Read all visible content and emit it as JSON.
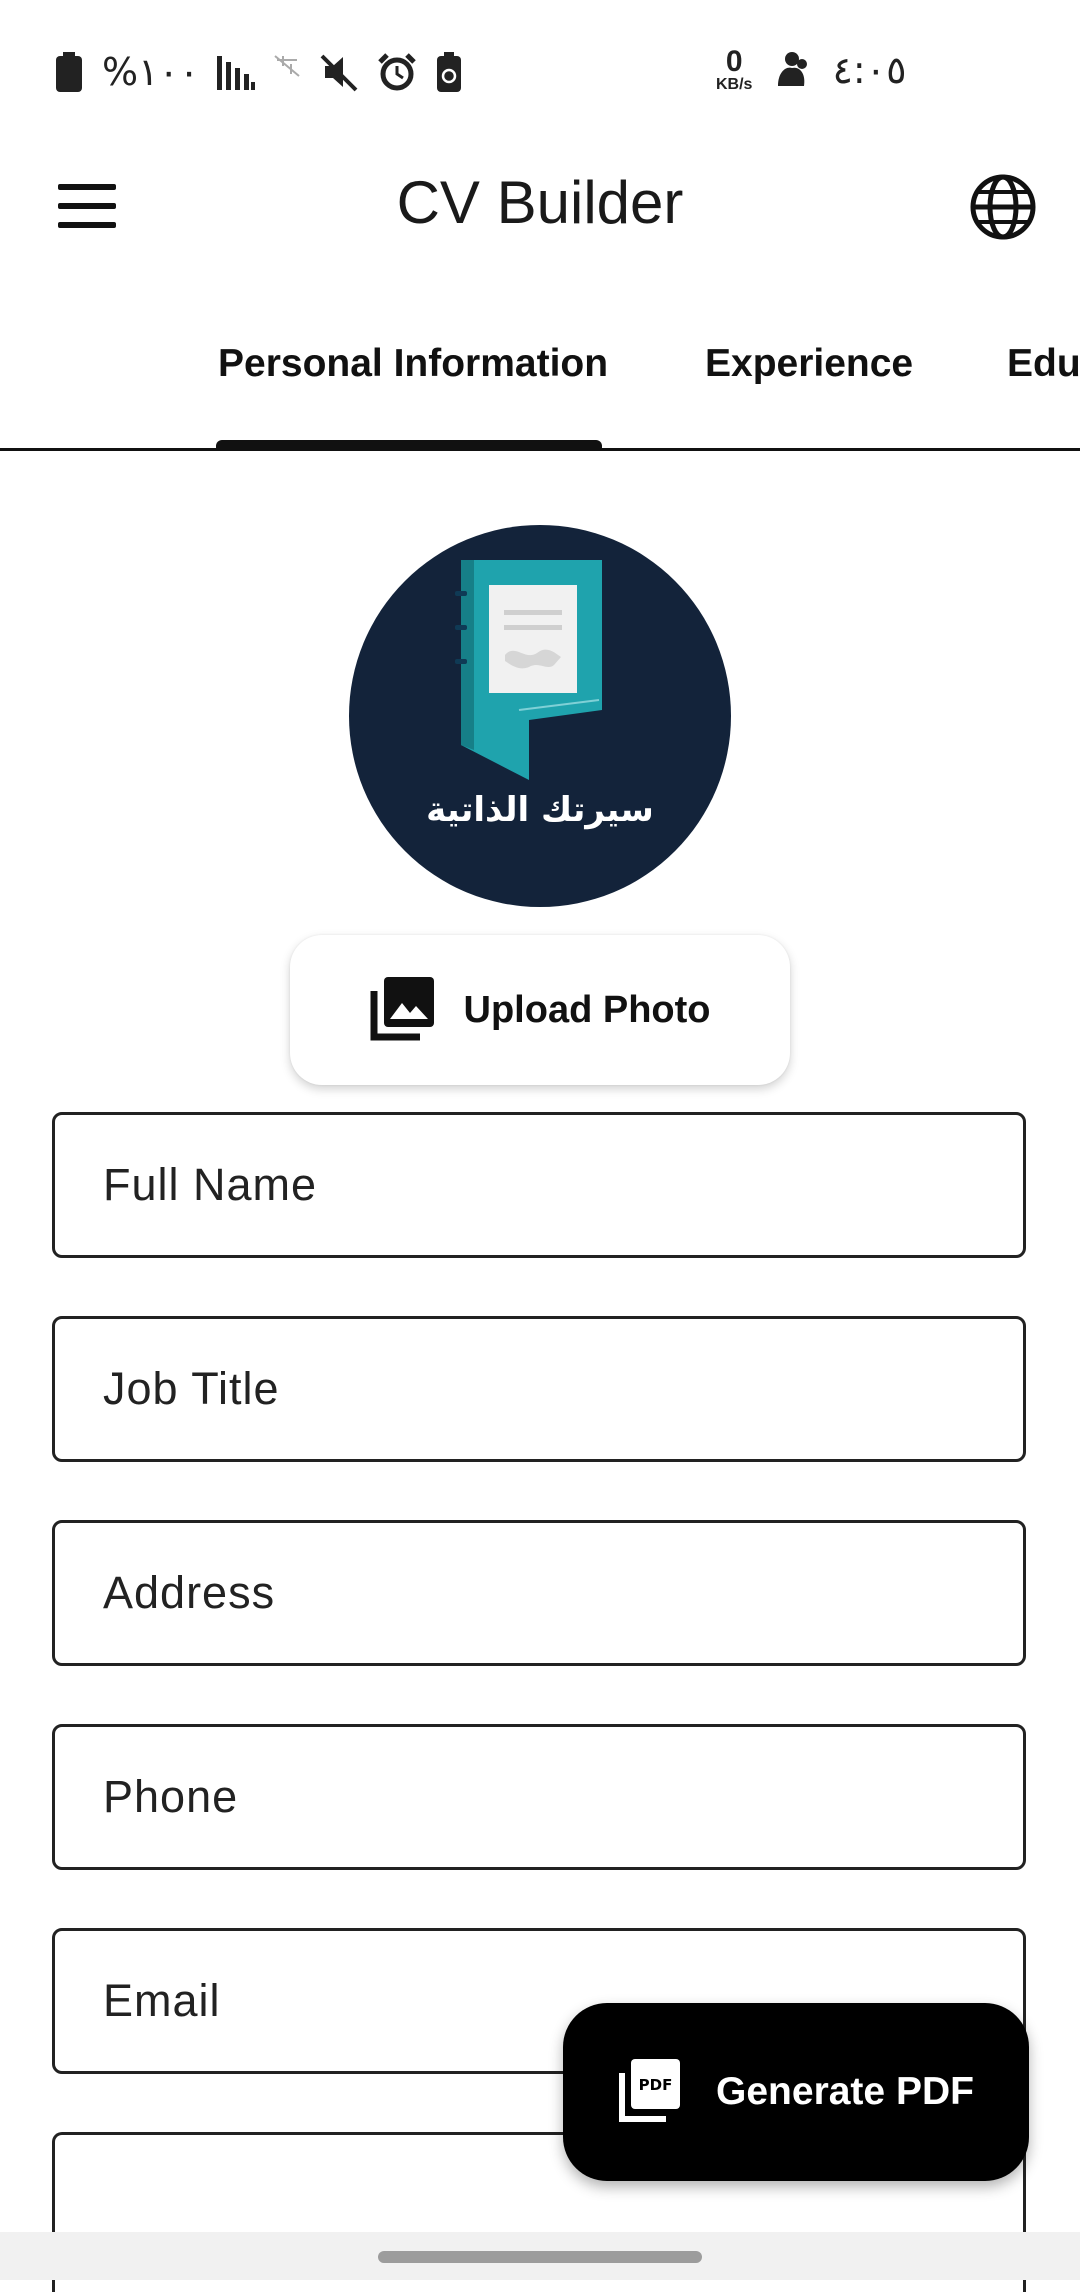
{
  "status_bar": {
    "battery_text": "%١٠٠",
    "speed_value": "0",
    "speed_unit": "KB/s",
    "time": "٤:٠٥",
    "icons": [
      "battery-icon",
      "signal-icon",
      "data-off-icon",
      "mute-icon",
      "alarm-icon",
      "battery-saver-icon",
      "speed-icon",
      "notification-icon"
    ]
  },
  "app_bar": {
    "title": "CV Builder",
    "menu_icon": "hamburger-menu-icon",
    "language_icon": "globe-icon"
  },
  "tabs": [
    {
      "label": "Personal Information",
      "active": true
    },
    {
      "label": "Experience",
      "active": false
    },
    {
      "label": "Education",
      "active": false
    }
  ],
  "profile": {
    "logo_text": "سيرتك الذاتية",
    "upload_label": "Upload Photo",
    "upload_icon": "photo-library-icon"
  },
  "form": {
    "full_name_placeholder": "Full Name",
    "job_title_placeholder": "Job Title",
    "address_placeholder": "Address",
    "phone_placeholder": "Phone",
    "email_placeholder": "Email",
    "extra_placeholder": ""
  },
  "fab": {
    "label": "Generate PDF",
    "icon": "pdf-icon"
  },
  "colors": {
    "avatar_bg": "#13233a",
    "logo_teal": "#1fa3ad",
    "fab_bg": "#000000"
  }
}
